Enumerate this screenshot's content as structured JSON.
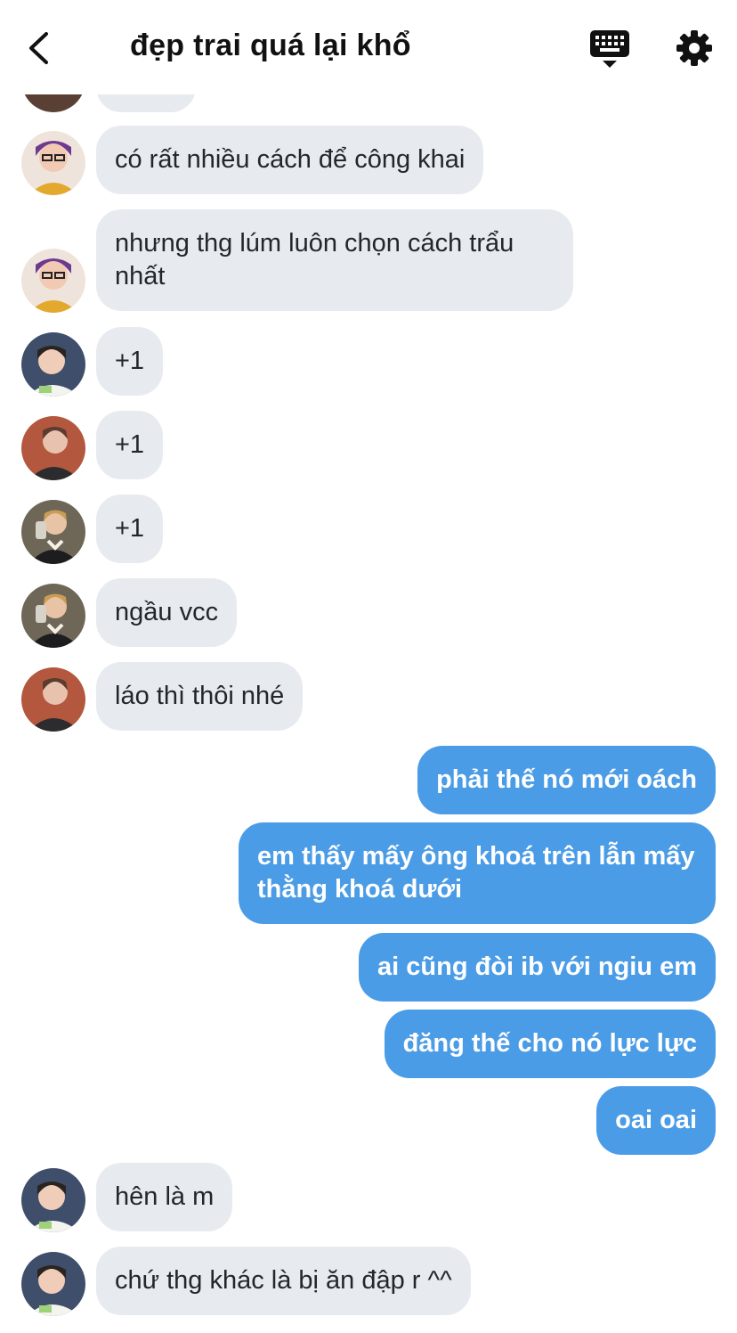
{
  "header": {
    "title": "đẹp trai quá lại khổ",
    "back_icon": "chevron-left-icon",
    "keyboard_icon": "keyboard-icon",
    "settings_icon": "gear-icon"
  },
  "colors": {
    "incoming_bubble": "#e7ebef",
    "outgoing_bubble": "#4b9ce6",
    "background": "#ffffff"
  },
  "messages": [
    {
      "direction": "in",
      "text": "có rất nhiều cách để công khai"
    },
    {
      "direction": "in",
      "text": "nhưng thg lúm luôn chọn cách trẩu nhất"
    },
    {
      "direction": "in",
      "text": "+1"
    },
    {
      "direction": "in",
      "text": "+1"
    },
    {
      "direction": "in",
      "text": "+1"
    },
    {
      "direction": "in",
      "text": "ngầu vcc"
    },
    {
      "direction": "in",
      "text": "láo thì thôi nhé"
    },
    {
      "direction": "out",
      "text": "phải thế nó mới oách"
    },
    {
      "direction": "out",
      "text": "em thấy mấy ông khoá trên lẫn mấy thằng khoá dưới"
    },
    {
      "direction": "out",
      "text": "ai cũng đòi ib với ngiu em"
    },
    {
      "direction": "out",
      "text": "đăng thế cho nó lực lực"
    },
    {
      "direction": "out",
      "text": "oai oai"
    },
    {
      "direction": "in",
      "text": "hên là m"
    },
    {
      "direction": "in",
      "text": "chứ thg khác là bị ăn đập r ^^"
    }
  ]
}
